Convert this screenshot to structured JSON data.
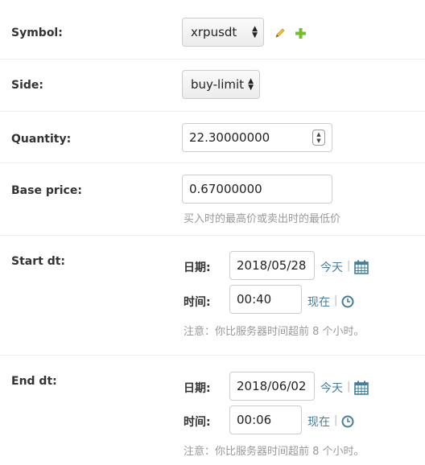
{
  "form": {
    "symbol": {
      "label": "Symbol:",
      "value": "xrpusdt",
      "icons": [
        "pencil-icon",
        "plus-icon"
      ]
    },
    "side": {
      "label": "Side:",
      "value": "buy-limit"
    },
    "quantity": {
      "label": "Quantity:",
      "value": "22.30000000"
    },
    "base_price": {
      "label": "Base price:",
      "value": "0.67000000",
      "help": "买入时的最高价或卖出时的最低价"
    },
    "start_dt": {
      "label": "Start dt:",
      "date_label": "日期:",
      "date_value": "2018/05/28",
      "date_link": "今天",
      "separator": "|",
      "time_label": "时间:",
      "time_value": "00:40",
      "time_link": "现在",
      "note": "注意：你比服务器时间超前 8 个小时。"
    },
    "end_dt": {
      "label": "End dt:",
      "date_label": "日期:",
      "date_value": "2018/06/02",
      "date_link": "今天",
      "separator": "|",
      "time_label": "时间:",
      "time_value": "00:06",
      "time_link": "现在",
      "note": "注意：你比服务器时间超前 8 个小时。"
    }
  },
  "colors": {
    "link": "#447e9b",
    "help": "#999999",
    "pencil": "#f0c040",
    "plus": "#70bf2b"
  }
}
